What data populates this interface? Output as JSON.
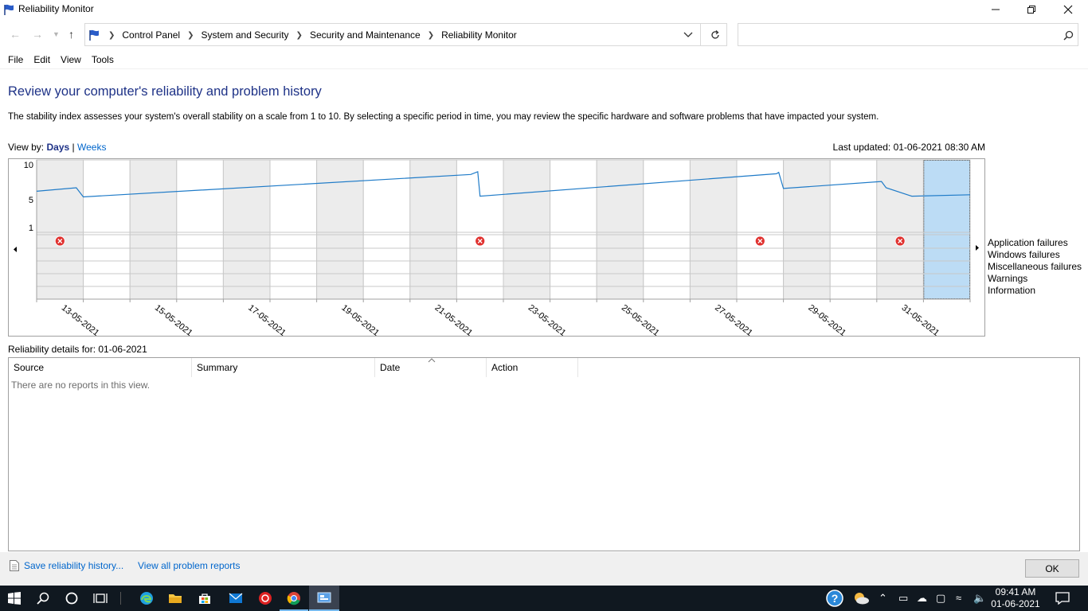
{
  "window": {
    "title": "Reliability Monitor",
    "minimize_label": "—",
    "restore_label": "❐",
    "close_label": "✕"
  },
  "breadcrumb": [
    "Control Panel",
    "System and Security",
    "Security and Maintenance",
    "Reliability Monitor"
  ],
  "search": {
    "placeholder": ""
  },
  "menu": [
    "File",
    "Edit",
    "View",
    "Tools"
  ],
  "main": {
    "heading": "Review your computer's reliability and problem history",
    "description": "The stability index assesses your system's overall stability on a scale from 1 to 10. By selecting a specific period in time, you may review the specific hardware and software problems that have impacted your system.",
    "view_by_label": "View by:",
    "view_days": "Days",
    "view_separator": "|",
    "view_weeks": "Weeks",
    "last_updated": "Last updated: 01-06-2021 08:30 AM"
  },
  "chart": {
    "y_ticks": [
      "10",
      "5",
      "1"
    ],
    "date_labels": [
      "13-05-2021",
      "15-05-2021",
      "17-05-2021",
      "19-05-2021",
      "21-05-2021",
      "23-05-2021",
      "25-05-2021",
      "27-05-2021",
      "29-05-2021",
      "31-05-2021"
    ],
    "legend": [
      "Application failures",
      "Windows failures",
      "Miscellaneous failures",
      "Warnings",
      "Information"
    ],
    "stability_points": [
      6.2,
      6.7,
      5.4,
      8.6,
      9.0,
      5.5,
      8.7,
      8.9,
      6.6,
      7.6,
      6.7,
      5.5,
      5.7
    ],
    "app_failure_dates": [
      "12-05-2021",
      "21-05-2021",
      "27-05-2021",
      "30-05-2021"
    ],
    "selected_date": "01-06-2021",
    "line_color": "#1f7bc8",
    "selected_color": "#bcdcf5",
    "failure_color": "#e0312f"
  },
  "details": {
    "label": "Reliability details for: 01-06-2021",
    "columns": [
      "Source",
      "Summary",
      "Date",
      "Action"
    ],
    "empty_text": "There are no reports in this view."
  },
  "footer": {
    "save_link": "Save reliability history...",
    "view_all_link": "View all problem reports",
    "ok_label": "OK"
  },
  "taskbar": {
    "time": "09:41 AM",
    "date": "01-06-2021"
  }
}
